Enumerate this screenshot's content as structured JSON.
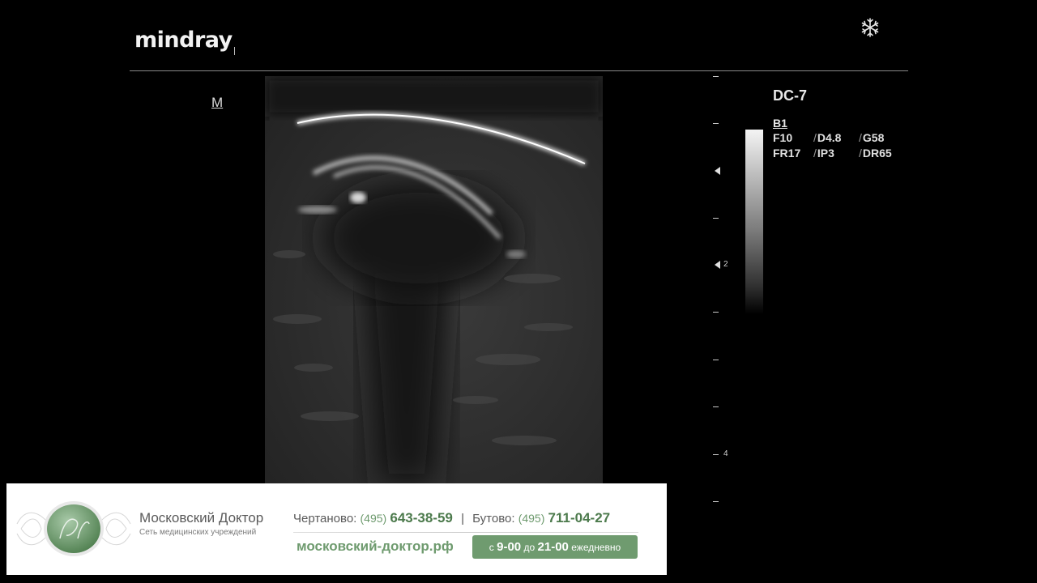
{
  "header": {
    "logo_text": "mindray",
    "freeze_icon": "snowflake-icon"
  },
  "image_marker": "M",
  "probe": {
    "name": "DC-7",
    "mode": "B1",
    "params": [
      [
        "F10",
        "D4.8",
        "G58"
      ],
      [
        "FR17",
        "IP3",
        "DR65"
      ]
    ]
  },
  "depth_scale": {
    "labels": [
      "2",
      "4"
    ]
  },
  "banner": {
    "clinic_name": "Московский Доктор",
    "clinic_subtitle": "Сеть медицинских учреждений",
    "location1": "Чертаново:",
    "code1": "(495)",
    "phone1": "643-38-59",
    "separator": "|",
    "location2": "Бутово:",
    "code2": "(495)",
    "phone2": "711-04-27",
    "website": "московский-доктор.рф",
    "hours_prefix": "с",
    "hours_open": "9-00",
    "hours_to": "до",
    "hours_close": "21-00",
    "hours_suffix": "ежедневно",
    "accent_color": "#6f9b6f"
  }
}
